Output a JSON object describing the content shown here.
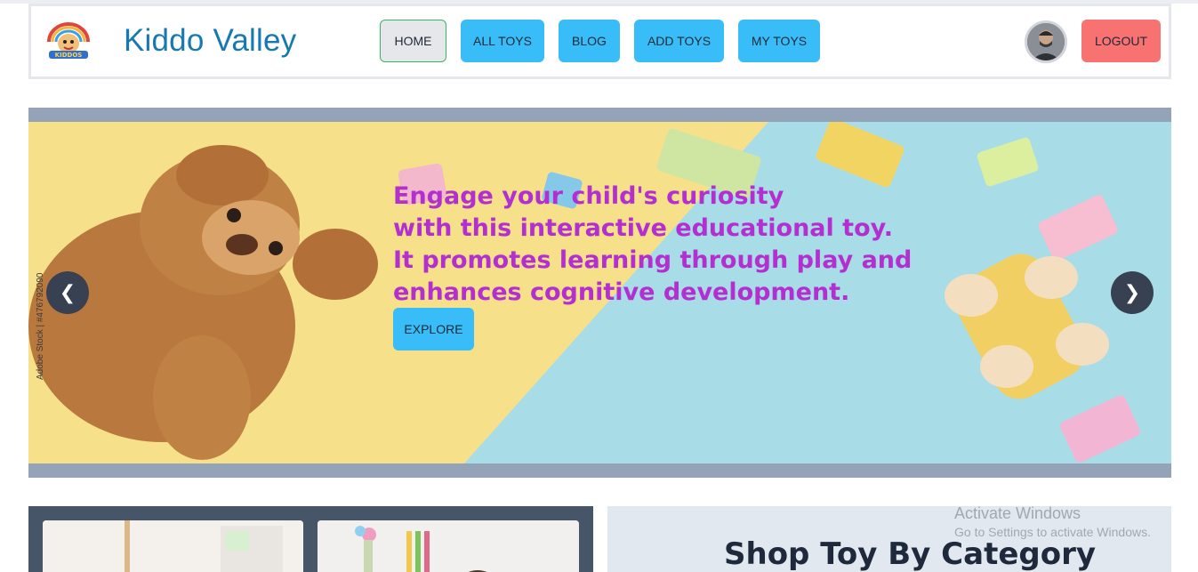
{
  "brand": {
    "title": "Kiddo Valley",
    "logo_text": "KIDDOS"
  },
  "nav": {
    "home": "HOME",
    "all_toys": "ALL TOYS",
    "blog": "BLOG",
    "add_toys": "ADD TOYS",
    "my_toys": "MY TOYS",
    "logout": "LOGOUT"
  },
  "hero": {
    "lines": [
      "Engage your child's curiosity",
      "with this interactive educational toy.",
      "It promotes learning through play and",
      "enhances cognitive development."
    ],
    "explore": "EXPLORE",
    "prev": "❮",
    "next": "❯",
    "watermark": "Adobe Stock | #476792090"
  },
  "category": {
    "title": "Shop Toy By Category"
  },
  "os_overlay": {
    "line1": "Activate Windows",
    "line2": "Go to Settings to activate Windows."
  },
  "colors": {
    "brand": "#1679b2",
    "nav_button": "#38bdf8",
    "logout": "#f87272",
    "hero_text": "#b42fcf",
    "hero_yellow": "#f6e08a",
    "hero_blue": "#a8dde8"
  }
}
